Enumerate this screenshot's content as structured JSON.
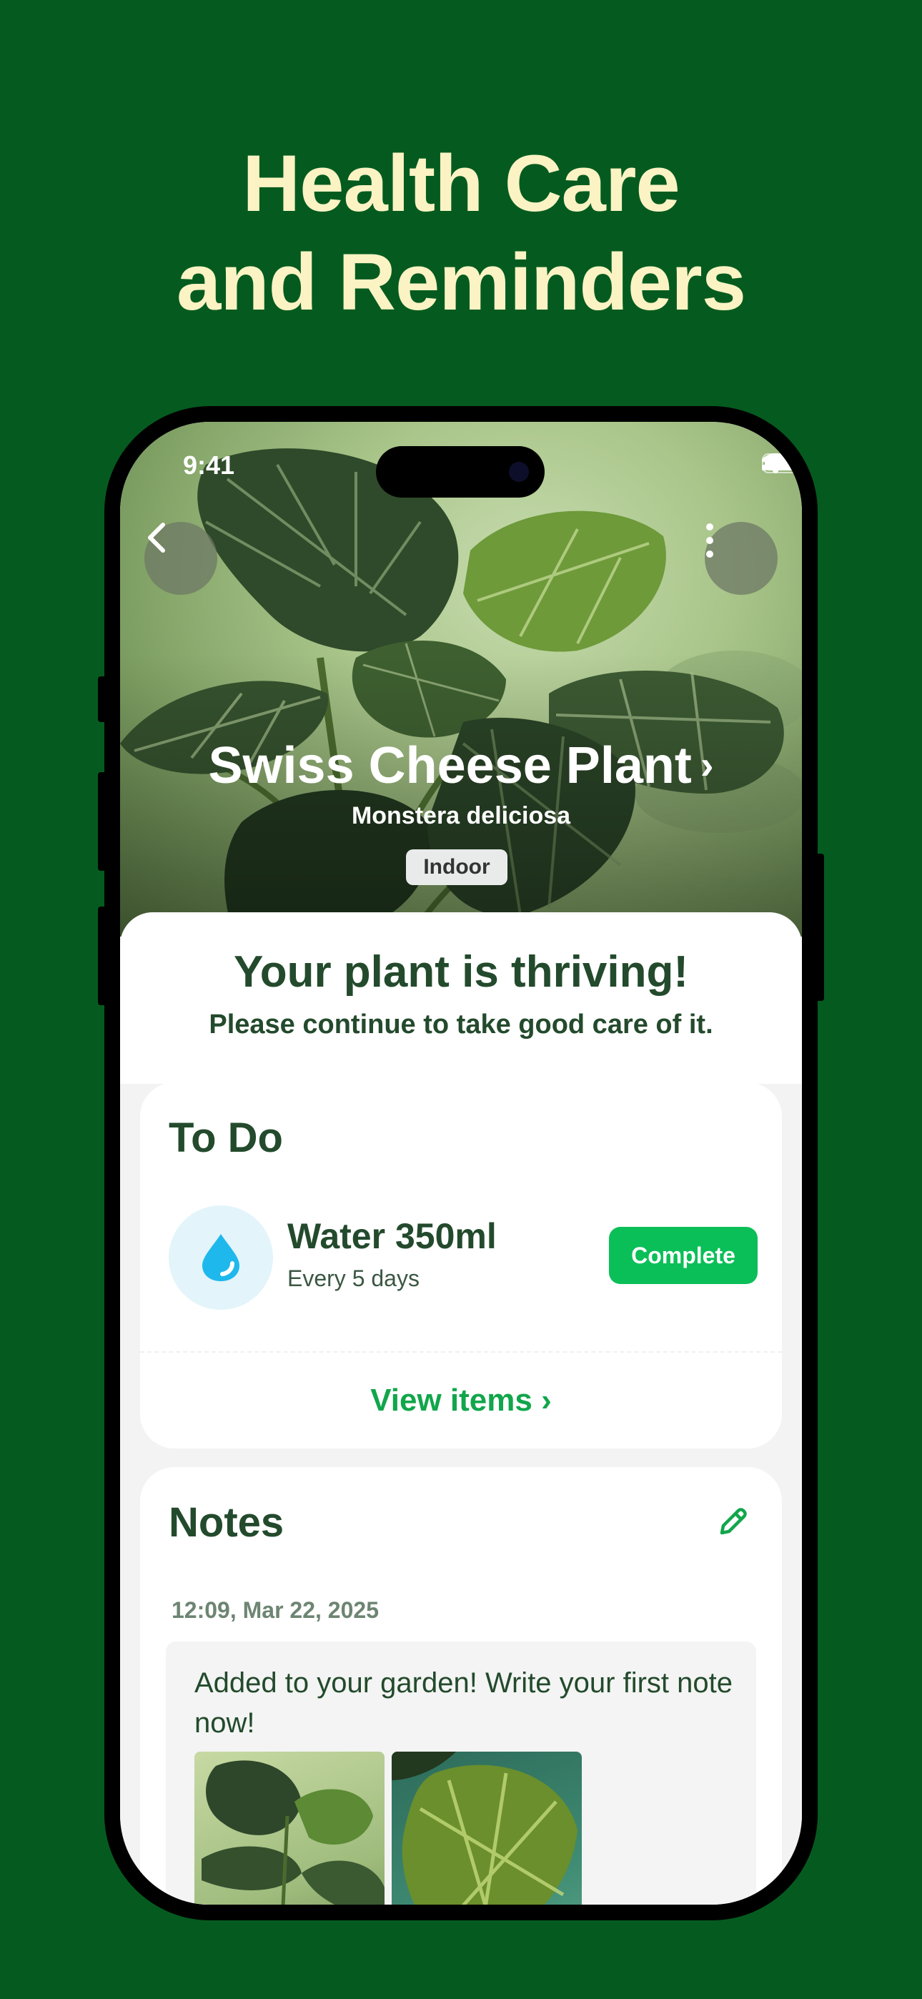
{
  "headline": {
    "line1": "Health Care",
    "line2": "and Reminders"
  },
  "status_bar": {
    "time": "9:41"
  },
  "plant": {
    "common_name": "Swiss Cheese Plant",
    "chevron": "›",
    "scientific_name": "Monstera deliciosa",
    "tag": "Indoor"
  },
  "status": {
    "headline": "Your plant is thriving!",
    "message": "Please continue to take good care of it."
  },
  "todo": {
    "title": "To Do",
    "task": {
      "icon": "water-drop-icon",
      "title": "Water 350ml",
      "frequency": "Every 5 days",
      "action": "Complete"
    },
    "view_items": "View items ›"
  },
  "notes": {
    "title": "Notes",
    "entries": [
      {
        "date": "12:09, Mar 22, 2025",
        "text": "Added to your garden! Write your first note now!"
      }
    ]
  },
  "colors": {
    "background": "#055b1f",
    "headline": "#fbf3c4",
    "text_dark_green": "#234a2c",
    "accent_green": "#0bbf58",
    "link_green": "#11a64b",
    "water_blue": "#1fb8ec"
  },
  "icons": [
    "back-chevron-icon",
    "more-vertical-icon",
    "signal-icon",
    "wifi-icon",
    "battery-icon",
    "water-drop-icon",
    "pencil-icon"
  ]
}
